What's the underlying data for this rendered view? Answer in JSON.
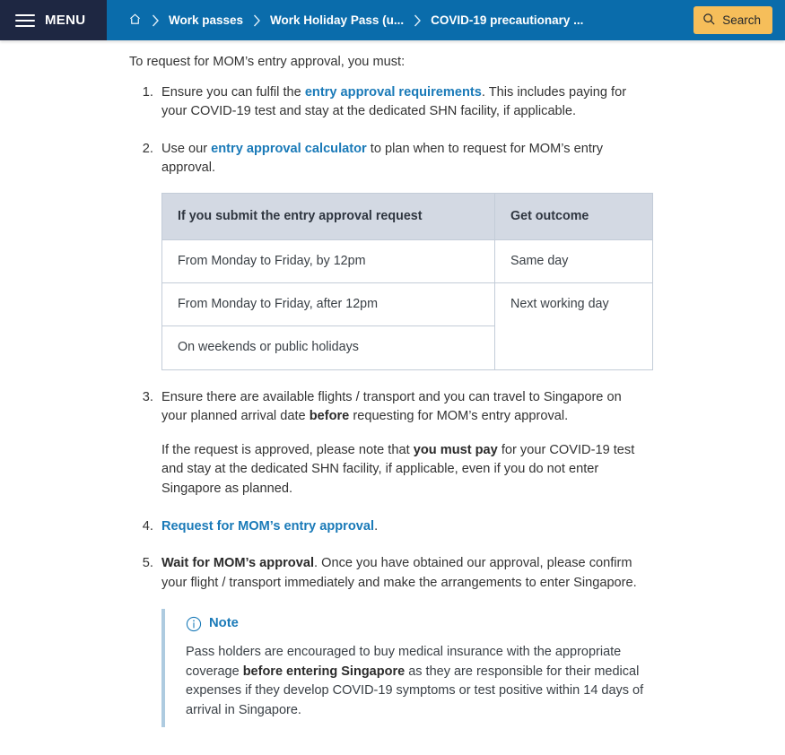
{
  "header": {
    "menu_label": "MENU",
    "menu_icon": "hamburger-icon",
    "home_icon": "home-icon",
    "separator_icon": "chevron-right-icon",
    "breadcrumbs": [
      {
        "label": "Work passes"
      },
      {
        "label": "Work Holiday Pass (u..."
      },
      {
        "label": "COVID-19 precautionary ..."
      }
    ],
    "search": {
      "label": "Search",
      "icon": "search-icon"
    },
    "colors": {
      "bar": "#0a6cab",
      "menu_block": "#1e2742",
      "search_button": "#f6be5a",
      "link": "#1a7ab8"
    }
  },
  "main": {
    "intro": "To request for MOM’s entry approval, you must:",
    "steps": {
      "step1": {
        "pre": "Ensure you can fulfil the ",
        "link": "entry approval requirements",
        "post": ". This includes paying for your COVID-19 test and stay at the dedicated SHN facility, if applicable."
      },
      "step2": {
        "pre": "Use our ",
        "link": "entry approval calculator",
        "post": " to plan when to request for MOM’s entry approval."
      },
      "step3": {
        "para1_pre": "Ensure there are available flights / transport and you can travel to Singapore on your planned arrival date ",
        "para1_bold": "before",
        "para1_post": " requesting for MOM’s entry approval.",
        "para2_pre": "If the request is approved, please note that ",
        "para2_bold": "you must pay",
        "para2_post": " for your COVID-19 test and stay at the dedicated SHN facility, if applicable, even if you do not enter Singapore as planned."
      },
      "step4": {
        "link": "Request for MOM’s entry approval",
        "post": "."
      },
      "step5": {
        "bold": "Wait for MOM’s approval",
        "post": ". Once you have obtained our approval, please confirm your flight / transport immediately and make the arrangements to enter Singapore."
      }
    },
    "table": {
      "headers": [
        "If you submit the entry approval request",
        "Get outcome"
      ],
      "rows": [
        {
          "condition": "From Monday to Friday, by 12pm",
          "outcome": "Same day",
          "outcome_rowspan": 1
        },
        {
          "condition": "From Monday to Friday, after 12pm",
          "outcome": "Next working day",
          "outcome_rowspan": 2
        },
        {
          "condition": "On weekends or public holidays",
          "outcome": null,
          "outcome_rowspan": 0
        }
      ]
    },
    "note": {
      "icon": "info-circle-icon",
      "title": "Note",
      "body_pre": "Pass holders are encouraged to buy medical insurance with the appropriate coverage ",
      "body_bold": "before entering Singapore",
      "body_post": " as they are responsible for their medical expenses if they develop COVID-19 symptoms or test positive within 14 days of arrival in Singapore."
    }
  }
}
